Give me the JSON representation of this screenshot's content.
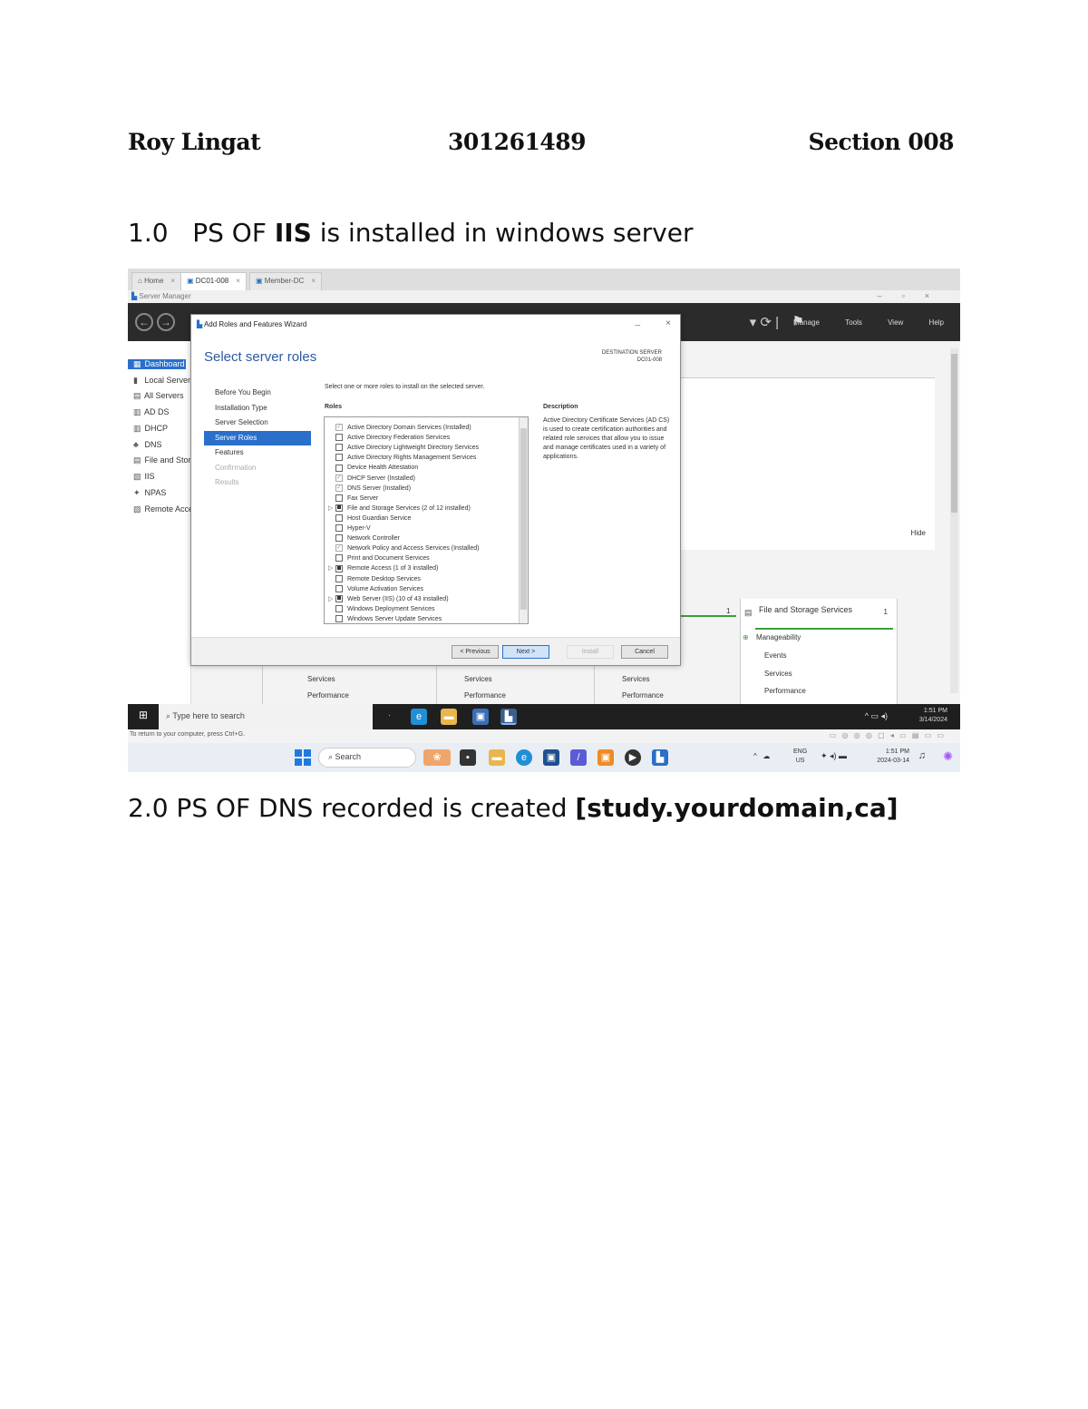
{
  "header": {
    "name": "Roy Lingat",
    "student_id": "301261489",
    "section": "Section 008"
  },
  "headings": {
    "h1": {
      "prefix": "1.0   PS OF ",
      "bold": "IIS",
      "suffix": " is installed in windows server"
    },
    "h2": {
      "prefix": "2.0 PS OF DNS recorded is created ",
      "bold": "[study.yourdomain,ca]"
    }
  },
  "screenshot": {
    "tabs": [
      {
        "label": "Home",
        "icon": "home-icon"
      },
      {
        "label": "DC01-008",
        "icon": "vm-icon"
      },
      {
        "label": "Member-DC",
        "icon": "vm-icon"
      }
    ],
    "window_title": "Server Manager",
    "menu": [
      "Manage",
      "Tools",
      "View",
      "Help"
    ],
    "sidebar": [
      {
        "label": "Dashboard",
        "icon": "dashboard-icon",
        "selected": true
      },
      {
        "label": "Local Server",
        "icon": "server-icon"
      },
      {
        "label": "All Servers",
        "icon": "servers-icon"
      },
      {
        "label": "AD DS",
        "icon": "ad-icon"
      },
      {
        "label": "DHCP",
        "icon": "dhcp-icon"
      },
      {
        "label": "DNS",
        "icon": "dns-icon"
      },
      {
        "label": "File and Storage Services",
        "icon": "file-storage-icon"
      },
      {
        "label": "IIS",
        "icon": "iis-icon"
      },
      {
        "label": "NPAS",
        "icon": "npas-icon"
      },
      {
        "label": "Remote Access",
        "icon": "remote-access-icon"
      }
    ],
    "hide_link": "Hide",
    "wizard": {
      "title": "Add Roles and Features Wizard",
      "heading": "Select server roles",
      "destination_label": "DESTINATION SERVER",
      "destination_value": "DC01-008",
      "steps": [
        {
          "label": "Before You Begin",
          "state": "normal"
        },
        {
          "label": "Installation Type",
          "state": "normal"
        },
        {
          "label": "Server Selection",
          "state": "normal"
        },
        {
          "label": "Server Roles",
          "state": "selected"
        },
        {
          "label": "Features",
          "state": "normal"
        },
        {
          "label": "Confirmation",
          "state": "dim"
        },
        {
          "label": "Results",
          "state": "dim"
        }
      ],
      "instruction": "Select one or more roles to install on the selected server.",
      "roles_header": "Roles",
      "description_header": "Description",
      "roles": [
        {
          "label": "Active Directory Domain Services (Installed)",
          "checked": "check"
        },
        {
          "label": "Active Directory Federation Services",
          "checked": "none"
        },
        {
          "label": "Active Directory Lightweight Directory Services",
          "checked": "none"
        },
        {
          "label": "Active Directory Rights Management Services",
          "checked": "none"
        },
        {
          "label": "Device Health Attestation",
          "checked": "none"
        },
        {
          "label": "DHCP Server (Installed)",
          "checked": "check"
        },
        {
          "label": "DNS Server (Installed)",
          "checked": "check"
        },
        {
          "label": "Fax Server",
          "checked": "none"
        },
        {
          "label": "File and Storage Services (2 of 12 installed)",
          "checked": "partial",
          "expandable": true
        },
        {
          "label": "Host Guardian Service",
          "checked": "none"
        },
        {
          "label": "Hyper-V",
          "checked": "none"
        },
        {
          "label": "Network Controller",
          "checked": "none"
        },
        {
          "label": "Network Policy and Access Services (Installed)",
          "checked": "check"
        },
        {
          "label": "Print and Document Services",
          "checked": "none"
        },
        {
          "label": "Remote Access (1 of 3 installed)",
          "checked": "partial",
          "expandable": true
        },
        {
          "label": "Remote Desktop Services",
          "checked": "none"
        },
        {
          "label": "Volume Activation Services",
          "checked": "none"
        },
        {
          "label": "Web Server (IIS) (10 of 43 installed)",
          "checked": "partial",
          "expandable": true
        },
        {
          "label": "Windows Deployment Services",
          "checked": "none"
        },
        {
          "label": "Windows Server Update Services",
          "checked": "none"
        }
      ],
      "description": "Active Directory Certificate Services (AD CS) is used to create certification authorities and related role services that allow you to issue and manage certificates used in a variety of applications.",
      "buttons": {
        "previous": "< Previous",
        "next": "Next >",
        "install": "Install",
        "cancel": "Cancel"
      }
    },
    "tiles": {
      "count": "1",
      "file_storage_title": "File and Storage Services",
      "file_storage_count": "1",
      "manageability": "Manageability",
      "events": "Events",
      "services": "Services",
      "performance": "Performance"
    },
    "vm_taskbar": {
      "search_placeholder": "Type here to search",
      "time": "1:51 PM",
      "date": "3/14/2024"
    },
    "status_text": "To return to your computer, press Ctrl+G.",
    "host_taskbar": {
      "search_placeholder": "Search",
      "lang_1": "ENG",
      "lang_2": "US",
      "time": "1:51 PM",
      "date": "2024-03-14"
    }
  }
}
